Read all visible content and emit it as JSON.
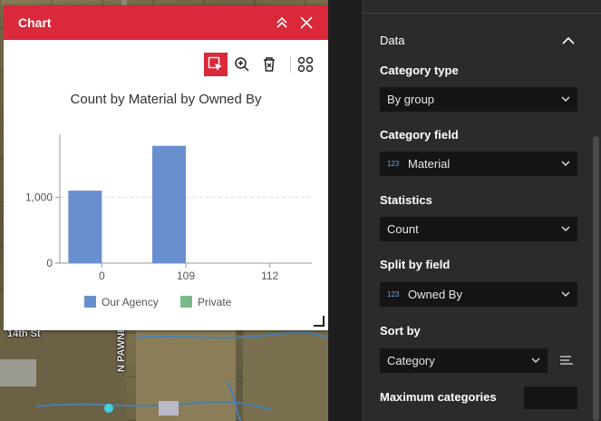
{
  "widget": {
    "title": "Chart",
    "accent_color": "#d9293a",
    "header_icons": [
      "collapse-up-icon",
      "close-icon"
    ],
    "toolbar_icons": [
      "select-filter-icon",
      "zoom-in-icon",
      "clear-selection-icon",
      "more-options-icon"
    ]
  },
  "map": {
    "road_label_1": "14th St",
    "road_label_2": "N PAWNEE A"
  },
  "chart_data": {
    "type": "bar",
    "title": "Count by Material by Owned By",
    "categories": [
      "0",
      "109",
      "112"
    ],
    "series": [
      {
        "name": "Our Agency",
        "color": "#6a8fcf",
        "values": [
          1100,
          1780,
          0
        ]
      },
      {
        "name": "Private",
        "color": "#7cb98a",
        "values": [
          0,
          0,
          0
        ]
      }
    ],
    "y_ticks": [
      "0",
      "1,000"
    ],
    "ylim": [
      0,
      1900
    ],
    "grid": true,
    "legend_position": "bottom"
  },
  "panel": {
    "section_title": "Data",
    "category_type_label": "Category type",
    "category_type_value": "By group",
    "category_field_label": "Category field",
    "category_field_value": "Material",
    "statistics_label": "Statistics",
    "statistics_value": "Count",
    "split_by_label": "Split by field",
    "split_by_value": "Owned By",
    "sort_by_label": "Sort by",
    "sort_by_value": "Category",
    "max_categories_label": "Maximum categories",
    "max_categories_value": "",
    "numeric_badge": "123"
  }
}
